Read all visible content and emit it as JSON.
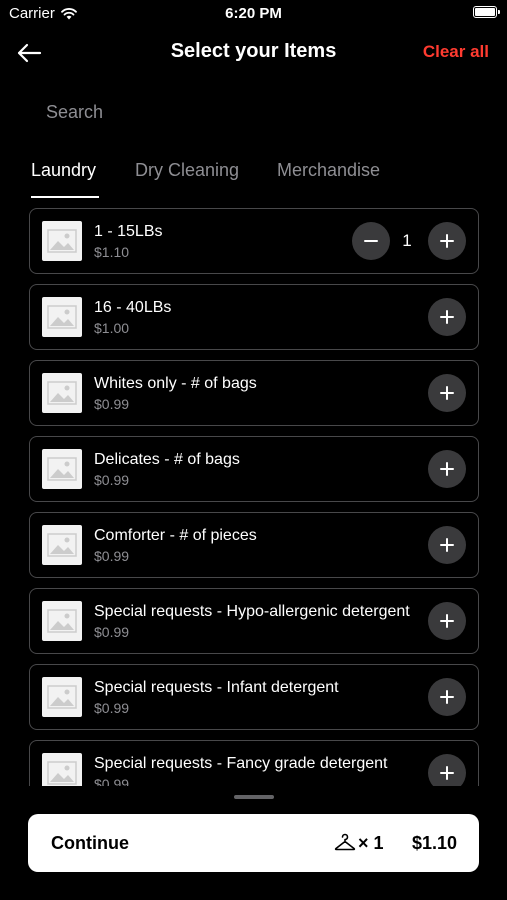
{
  "status_bar": {
    "carrier": "Carrier",
    "time": "6:20 PM"
  },
  "nav": {
    "title": "Select your Items",
    "clear_label": "Clear all"
  },
  "search": {
    "placeholder": "Search"
  },
  "tabs": [
    {
      "label": "Laundry",
      "active": true
    },
    {
      "label": "Dry Cleaning",
      "active": false
    },
    {
      "label": "Merchandise",
      "active": false
    }
  ],
  "items": [
    {
      "name": "1 - 15LBs",
      "price": "$1.10",
      "quantity": "1"
    },
    {
      "name": "16 - 40LBs",
      "price": "$1.00"
    },
    {
      "name": "Whites only - # of bags",
      "price": "$0.99"
    },
    {
      "name": "Delicates - # of bags",
      "price": "$0.99"
    },
    {
      "name": "Comforter - # of pieces",
      "price": "$0.99"
    },
    {
      "name": "Special requests - Hypo-allergenic detergent",
      "price": "$0.99"
    },
    {
      "name": "Special requests - Infant detergent",
      "price": "$0.99"
    },
    {
      "name": "Special requests - Fancy grade detergent",
      "price": "$0.99"
    }
  ],
  "footer": {
    "continue_label": "Continue",
    "count": "× 1",
    "total": "$1.10"
  },
  "colors": {
    "accent": "#ff3b30",
    "background": "#000000",
    "button": "#3a3a3c"
  }
}
